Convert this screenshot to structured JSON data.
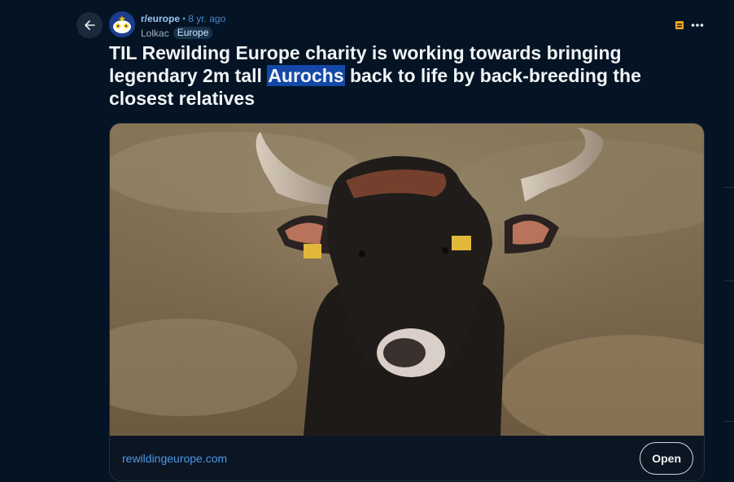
{
  "post": {
    "subreddit": "r/europe",
    "separator": "•",
    "age": "8 yr. ago",
    "author": "Lolkac",
    "flair": "Europe",
    "title_before": "TIL Rewilding Europe charity is working towards bringing legendary 2m tall ",
    "title_highlight": "Aurochs",
    "title_after": " back to life by back-breeding the closest relatives"
  },
  "link": {
    "domain": "rewildingeurope.com",
    "open_label": "Open"
  },
  "icons": {
    "back": "back-arrow-icon",
    "avatar": "subreddit-avatar-icon",
    "save": "archive-save-icon",
    "more": "more-options-icon"
  },
  "colors": {
    "background": "#041424",
    "highlight": "#1448a8",
    "link": "#4e96ea",
    "save_icon": "#f5a623"
  }
}
